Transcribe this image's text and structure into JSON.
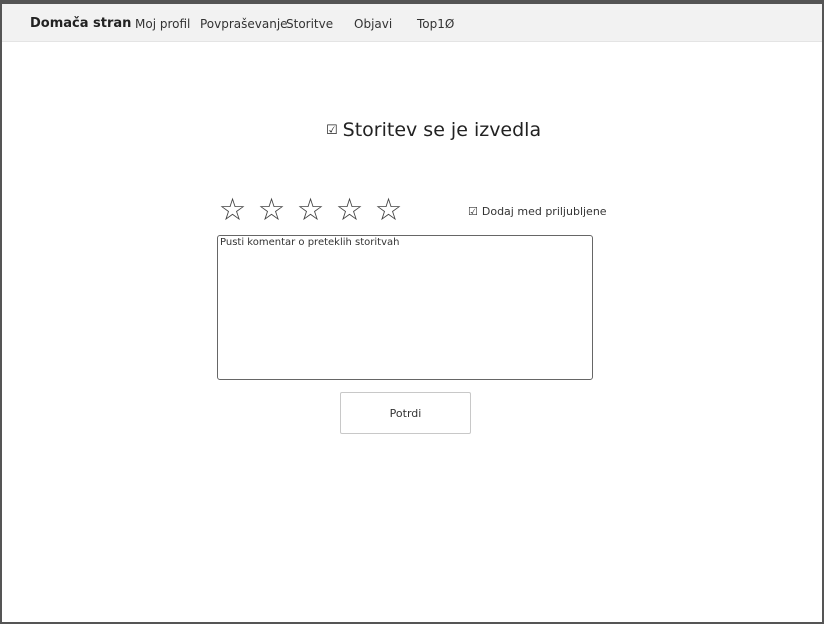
{
  "nav": {
    "brand": "Domača stran",
    "items": [
      "Moj profil",
      "Povpraševanje",
      "Storitve",
      "Objavi",
      "Top1Ø"
    ]
  },
  "main": {
    "heading_check_icon": "checkbox-checked-icon",
    "heading": "Storitev se je izvedla",
    "rating": {
      "max": 5,
      "value": 0,
      "star_glyph": "☆"
    },
    "favorite": {
      "checked": true,
      "label": "Dodaj med priljubljene"
    },
    "comment": {
      "placeholder": "Pusti komentar o preteklih storitvah",
      "value": ""
    },
    "confirm_label": "Potrdi"
  },
  "colors": {
    "navbar_bg": "#f2f2f2",
    "frame_border": "#555555",
    "text": "#222222"
  }
}
